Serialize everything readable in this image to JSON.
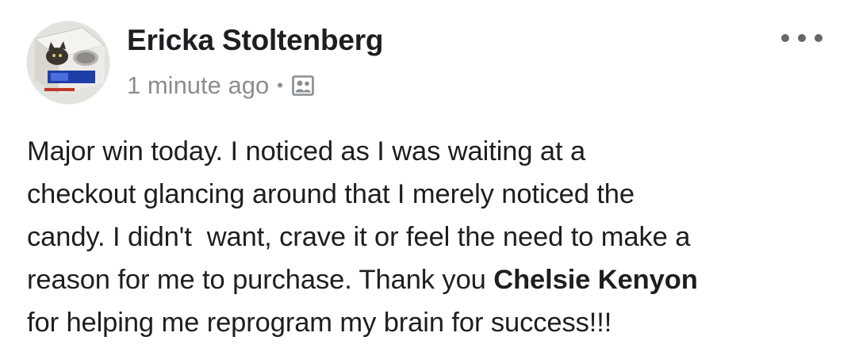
{
  "post": {
    "author_name": "Ericka Stoltenberg",
    "timestamp": "1 minute ago",
    "separator": "•",
    "privacy_icon": "group-privacy-icon",
    "more_icon": "more-options-icon",
    "avatar_icon": "profile-photo-cat-icon",
    "text_lines": [
      "Major win today. I noticed as I was waiting at a",
      "checkout glancing around that I merely noticed the",
      "candy. I didn't  want, crave it or feel the need to make a"
    ],
    "line4_before": "reason for me to purchase. Thank you ",
    "mention": "Chelsie Kenyon",
    "line5": "for helping me reprogram my brain for success!!!"
  },
  "colors": {
    "text": "#1c1e21",
    "meta": "#8a8d91",
    "icon": "#65676b",
    "background": "#ffffff"
  }
}
